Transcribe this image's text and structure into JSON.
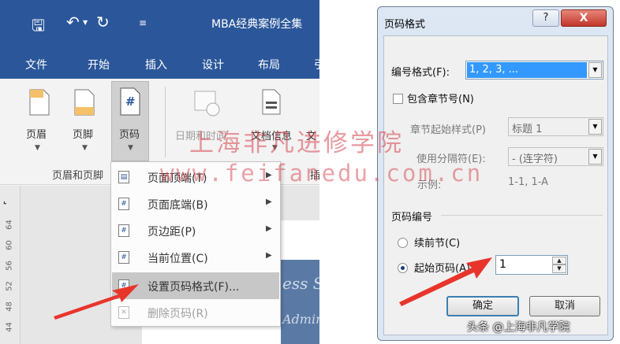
{
  "word": {
    "title": "MBA经典案例全集",
    "tabs": [
      "文件",
      "开始",
      "插入",
      "设计",
      "布局"
    ],
    "ribbon_buttons": {
      "header": "页眉",
      "footer": "页脚",
      "page_number": "页码",
      "datetime": "日期和时间",
      "docinfo": "文档信息",
      "docinfo_cut": "文"
    },
    "group_label": "页眉和页脚",
    "group_label_partial": "插",
    "ruler_numbers": [
      "44",
      "48",
      "52",
      "56",
      "60",
      "64"
    ],
    "faded_text": [
      "ess S",
      "Admin"
    ],
    "menu": {
      "items": [
        {
          "label": "页面顶端(T)",
          "submenu": true,
          "state": "normal"
        },
        {
          "label": "页面底端(B)",
          "submenu": true,
          "state": "normal"
        },
        {
          "label": "页边距(P)",
          "submenu": true,
          "state": "normal"
        },
        {
          "label": "当前位置(C)",
          "submenu": true,
          "state": "normal"
        },
        {
          "label": "设置页码格式(F)...",
          "submenu": false,
          "state": "hover"
        },
        {
          "label": "删除页码(R)",
          "submenu": false,
          "state": "disabled"
        }
      ]
    }
  },
  "dialog": {
    "title": "页码格式",
    "help": "?",
    "close": "X",
    "number_format_label": "编号格式(F):",
    "number_format_value": "1, 2, 3, ...",
    "include_chapter_label": "包含章节号(N)",
    "chapter_style_label": "章节起始样式(P)",
    "chapter_style_value": "标题 1",
    "separator_label": "使用分隔符(E):",
    "separator_value": "-  (连字符)",
    "example_label": "示例:",
    "example_value": "1-1, 1-A",
    "page_numbering_section": "页码编号",
    "continue_label": "续前节(C)",
    "start_at_label": "起始页码(A):",
    "start_at_value": "1",
    "ok": "确定",
    "cancel": "取消"
  },
  "watermark": {
    "line1": "上海非凡进修学院",
    "line2": "www.feifanedu.com.cn"
  },
  "credit": "头条 @上海非凡学院",
  "colors": {
    "word_blue": "#2b579a",
    "arrow_red": "#e8352c",
    "watermark_red": "#d64650"
  }
}
